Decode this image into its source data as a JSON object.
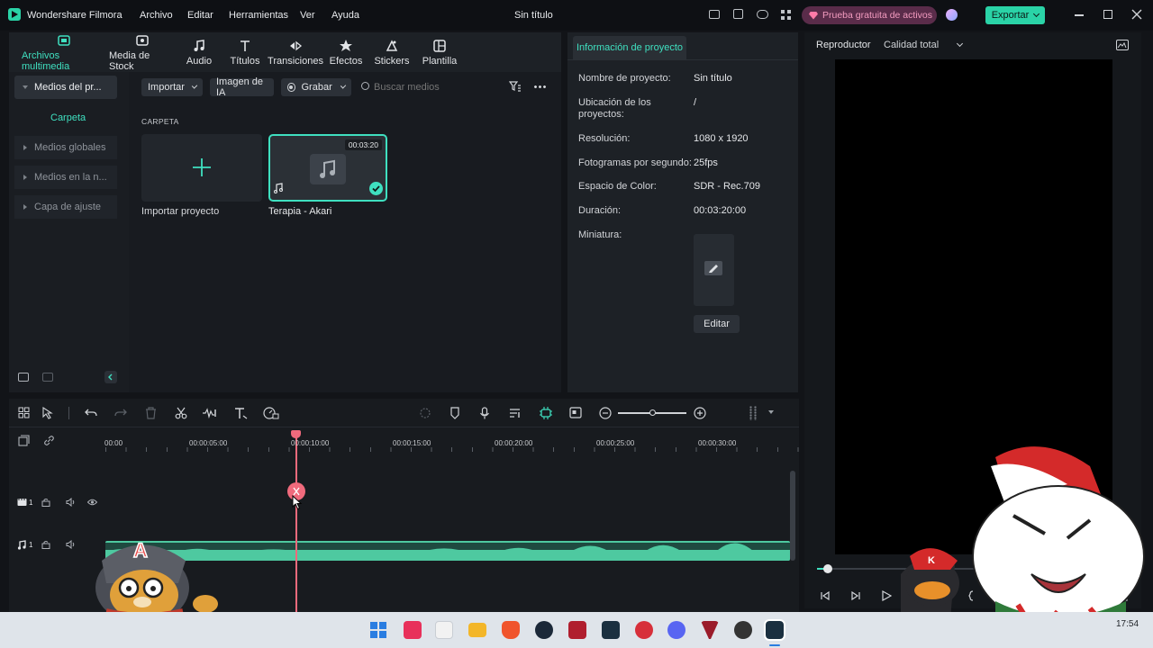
{
  "app": {
    "name": "Wondershare Filmora",
    "menu": [
      "Archivo",
      "Editar",
      "Herramientas",
      "Ver",
      "Ayuda"
    ],
    "project_title": "Sin título",
    "trial_label": "Prueba gratuita de activos",
    "export_label": "Exportar"
  },
  "nav_tabs": [
    {
      "label": "Archivos multimedia",
      "icon": "folder-media-icon",
      "active": true
    },
    {
      "label": "Media de Stock",
      "icon": "stock-media-icon"
    },
    {
      "label": "Audio",
      "icon": "music-note-icon"
    },
    {
      "label": "Títulos",
      "icon": "text-t-icon"
    },
    {
      "label": "Transiciones",
      "icon": "transition-icon"
    },
    {
      "label": "Efectos",
      "icon": "effects-icon"
    },
    {
      "label": "Stickers",
      "icon": "sticker-icon"
    },
    {
      "label": "Plantilla",
      "icon": "template-icon"
    }
  ],
  "sidebar": {
    "project_media": "Medios del pr...",
    "folder": "Carpeta",
    "items": [
      "Medios globales",
      "Medios en la n...",
      "Capa de ajuste"
    ]
  },
  "media_toolbar": {
    "import": "Importar",
    "ai_image": "Imagen de IA",
    "record": "Grabar",
    "search_placeholder": "Buscar medios"
  },
  "media": {
    "section_label": "CARPETA",
    "import_tile_label": "Importar proyecto",
    "audio_tile_label": "Terapia - Akari",
    "audio_duration": "00:03:20"
  },
  "project_info": {
    "tab": "Información de proyecto",
    "rows": [
      {
        "label": "Nombre de proyecto:",
        "value": "Sin título"
      },
      {
        "label": "Ubicación de los proyectos:",
        "value": "/"
      },
      {
        "label": "Resolución:",
        "value": "1080 x 1920"
      },
      {
        "label": "Fotogramas por segundo:",
        "value": "25fps"
      },
      {
        "label": "Espacio de Color:",
        "value": "SDR - Rec.709"
      },
      {
        "label": "Duración:",
        "value": "00:03:20:00"
      },
      {
        "label": "Miniatura:",
        "value": ""
      }
    ],
    "edit_button": "Editar"
  },
  "player": {
    "label": "Reproductor",
    "quality": "Calidad total"
  },
  "timeline": {
    "ruler": [
      "00:00",
      "00:00:05:00",
      "00:00:10:00",
      "00:00:15:00",
      "00:00:20:00",
      "00:00:25:00",
      "00:00:30:00"
    ],
    "video_track_number": "1",
    "audio_track_number": "1",
    "audio_color": "#4ec9a0",
    "playhead_color": "#f06a7c"
  },
  "taskbar": {
    "time": "17:54"
  },
  "colors": {
    "accent": "#3fe0c0",
    "export_bg": "#2ad3a7",
    "trial_bg": "#5a2c4a"
  }
}
